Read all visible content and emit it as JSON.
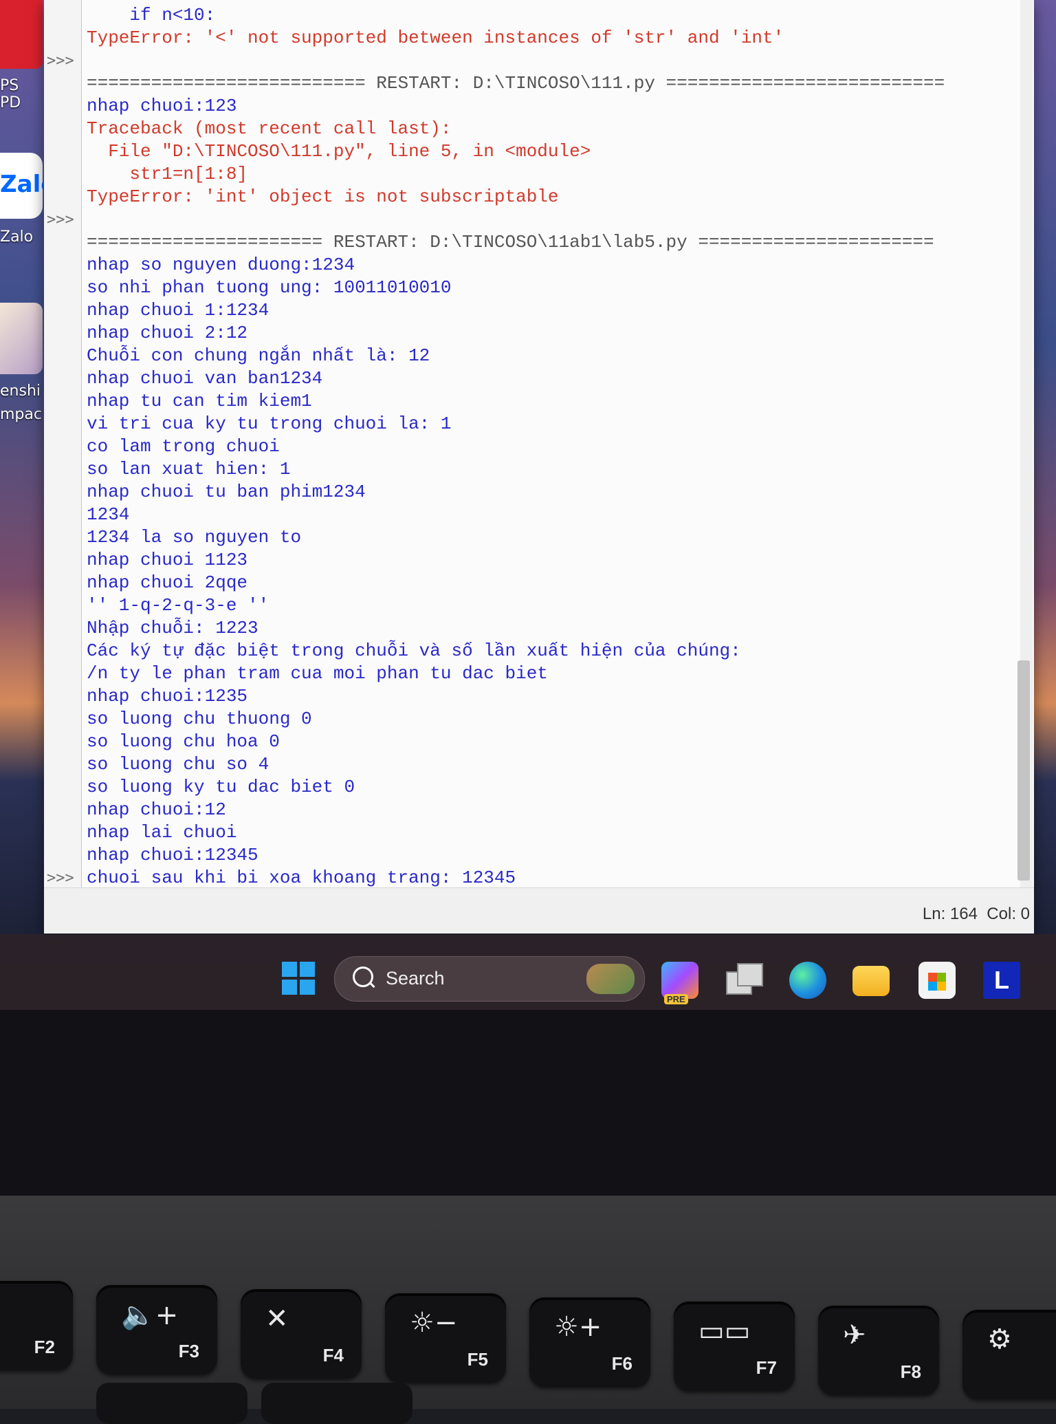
{
  "desktop": {
    "icons": [
      {
        "label": "PS PD"
      },
      {
        "label": "Zalo"
      },
      {
        "label": "enshi\nmpac"
      }
    ],
    "zalo_logo": "Zalo"
  },
  "idle": {
    "prompt": ">>>",
    "lines": [
      {
        "text": "    if n<10:",
        "style": "blue"
      },
      {
        "text": "TypeError: '<' not supported between instances of 'str' and 'int'",
        "style": "red"
      },
      {
        "text": "",
        "style": "blue"
      },
      {
        "text": "========================== RESTART: D:\\TINCOSO\\111.py ==========================",
        "style": "sep"
      },
      {
        "text": "nhap chuoi:123",
        "style": "blue"
      },
      {
        "text": "Traceback (most recent call last):",
        "style": "red"
      },
      {
        "text": "  File \"D:\\TINCOSO\\111.py\", line 5, in <module>",
        "style": "red"
      },
      {
        "text": "    str1=n[1:8]",
        "style": "red"
      },
      {
        "text": "TypeError: 'int' object is not subscriptable",
        "style": "red"
      },
      {
        "text": "",
        "style": "blue"
      },
      {
        "text": "====================== RESTART: D:\\TINCOSO\\11ab1\\lab5.py ======================",
        "style": "sep"
      },
      {
        "text": "nhap so nguyen duong:1234",
        "style": "blue"
      },
      {
        "text": "so nhi phan tuong ung: 10011010010",
        "style": "blue"
      },
      {
        "text": "nhap chuoi 1:1234",
        "style": "blue"
      },
      {
        "text": "nhap chuoi 2:12",
        "style": "blue"
      },
      {
        "text": "Chuỗi con chung ngắn nhất là: 12",
        "style": "blue"
      },
      {
        "text": "nhap chuoi van ban1234",
        "style": "blue"
      },
      {
        "text": "nhap tu can tim kiem1",
        "style": "blue"
      },
      {
        "text": "vi tri cua ky tu trong chuoi la: 1",
        "style": "blue"
      },
      {
        "text": "co lam trong chuoi",
        "style": "blue"
      },
      {
        "text": "so lan xuat hien: 1",
        "style": "blue"
      },
      {
        "text": "nhap chuoi tu ban phim1234",
        "style": "blue"
      },
      {
        "text": "1234",
        "style": "blue"
      },
      {
        "text": "1234 la so nguyen to",
        "style": "blue"
      },
      {
        "text": "nhap chuoi 1123",
        "style": "blue"
      },
      {
        "text": "nhap chuoi 2qqe",
        "style": "blue"
      },
      {
        "text": "'' 1-q-2-q-3-e ''",
        "style": "blue"
      },
      {
        "text": "Nhập chuỗi: 1223",
        "style": "blue"
      },
      {
        "text": "Các ký tự đặc biệt trong chuỗi và số lần xuất hiện của chúng:",
        "style": "blue"
      },
      {
        "text": "/n ty le phan tram cua moi phan tu dac biet",
        "style": "blue"
      },
      {
        "text": "nhap chuoi:1235",
        "style": "blue"
      },
      {
        "text": "so luong chu thuong 0",
        "style": "blue"
      },
      {
        "text": "so luong chu hoa 0",
        "style": "blue"
      },
      {
        "text": "so luong chu so 4",
        "style": "blue"
      },
      {
        "text": "so luong ky tu dac biet 0",
        "style": "blue"
      },
      {
        "text": "nhap chuoi:12",
        "style": "blue"
      },
      {
        "text": "nhap lai chuoi",
        "style": "blue"
      },
      {
        "text": "nhap chuoi:12345",
        "style": "blue"
      },
      {
        "text": "chuoi sau khi bi xoa khoang trang: 12345",
        "style": "blue"
      }
    ],
    "prompt_rows": [
      2,
      9,
      38
    ],
    "status": "Ln: 164  Col: 0"
  },
  "taskbar": {
    "search_label": "Search",
    "copilot_badge": "PRE",
    "pinned_letter": "L",
    "apps": [
      "start-icon",
      "copilot-icon",
      "task-view-icon",
      "edge-icon",
      "file-explorer-icon",
      "store-icon",
      "l-app-icon"
    ]
  },
  "keyboard": {
    "fkeys": [
      {
        "label": "F2",
        "icon": "‹"
      },
      {
        "label": "F3",
        "icon": "🔈+"
      },
      {
        "label": "F4",
        "icon": "✕"
      },
      {
        "label": "F5",
        "icon": "☼−"
      },
      {
        "label": "F6",
        "icon": "☼+"
      },
      {
        "label": "F7",
        "icon": "▭▭"
      },
      {
        "label": "F8",
        "icon": "✈"
      },
      {
        "label": "",
        "icon": "⚙"
      }
    ]
  },
  "colors": {
    "code_output": "#2929c9",
    "error": "#d13a2b",
    "separator": "#555555",
    "taskbar": "#2d2328"
  }
}
